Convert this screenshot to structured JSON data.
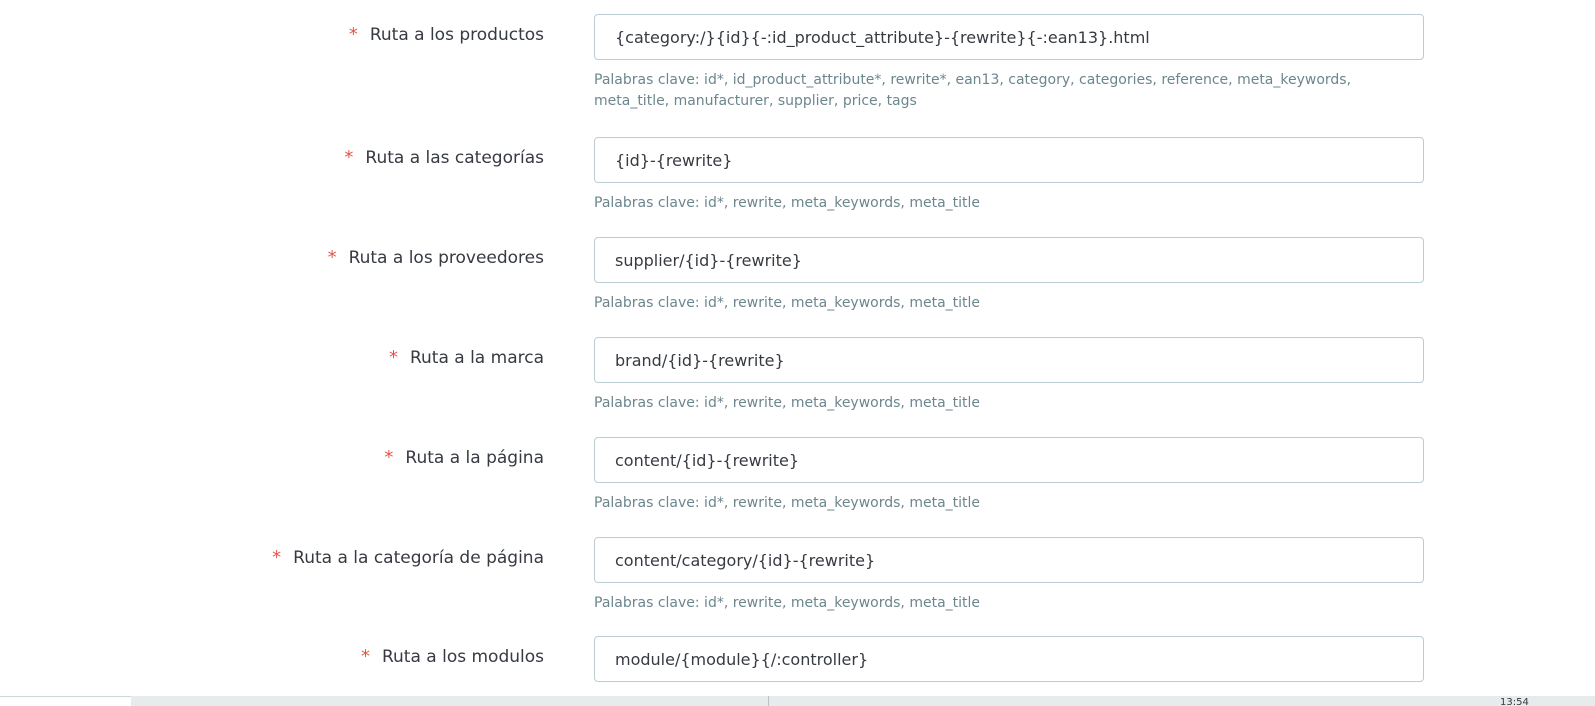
{
  "fields": [
    {
      "label": "Ruta a los productos",
      "required_mark": "*",
      "value": "{category:/}{id}{-:id_product_attribute}-{rewrite}{-:ean13}.html",
      "help": "Palabras clave: id*, id_product_attribute*, rewrite*, ean13, category, categories, reference, meta_keywords, meta_title, manufacturer, supplier, price, tags"
    },
    {
      "label": "Ruta a las categorías",
      "required_mark": "*",
      "value": "{id}-{rewrite}",
      "help": "Palabras clave: id*, rewrite, meta_keywords, meta_title"
    },
    {
      "label": "Ruta a los proveedores",
      "required_mark": "*",
      "value": "supplier/{id}-{rewrite}",
      "help": "Palabras clave: id*, rewrite, meta_keywords, meta_title"
    },
    {
      "label": "Ruta a la marca",
      "required_mark": "*",
      "value": "brand/{id}-{rewrite}",
      "help": "Palabras clave: id*, rewrite, meta_keywords, meta_title"
    },
    {
      "label": "Ruta a la página",
      "required_mark": "*",
      "value": "content/{id}-{rewrite}",
      "help": "Palabras clave: id*, rewrite, meta_keywords, meta_title"
    },
    {
      "label": "Ruta a la categoría de página",
      "required_mark": "*",
      "value": "content/category/{id}-{rewrite}",
      "help": "Palabras clave: id*, rewrite, meta_keywords, meta_title"
    },
    {
      "label": "Ruta a los modulos",
      "required_mark": "*",
      "value": "module/{module}{/:controller}",
      "help": ""
    }
  ],
  "taskbar": {
    "clock": "13:54"
  },
  "colors": {
    "required": "#e5564b",
    "label": "#363a41",
    "help": "#6c868e",
    "border": "#bbcdd2"
  }
}
